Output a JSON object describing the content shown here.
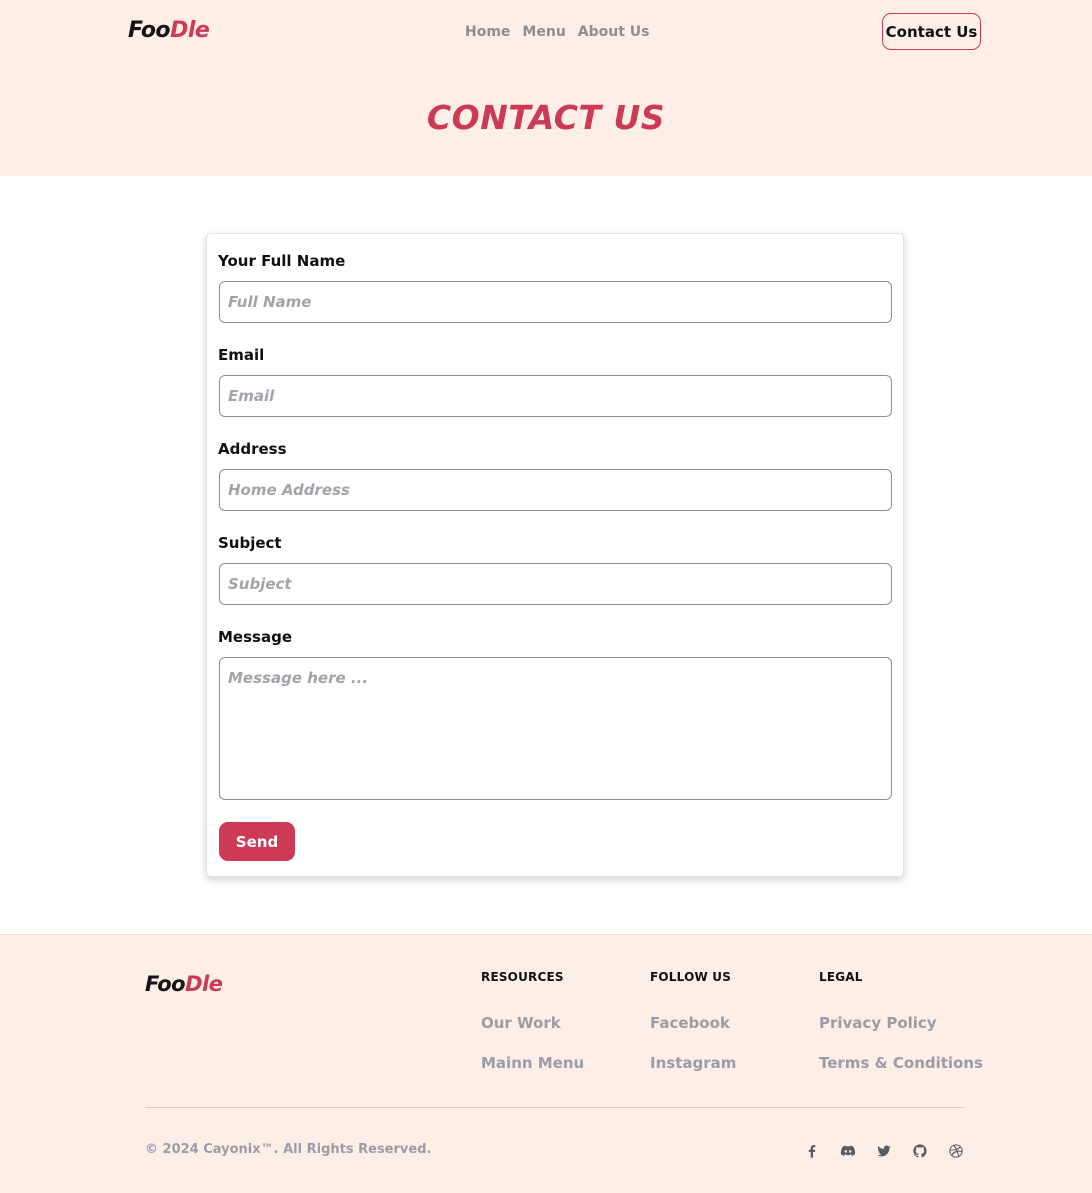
{
  "brand": {
    "part1": "Foo",
    "part2": "Dle"
  },
  "nav": {
    "home": "Home",
    "menu": "Menu",
    "about": "About Us"
  },
  "header": {
    "contact_button": "Contact Us",
    "title": "CONTACT US"
  },
  "form": {
    "fields": [
      {
        "label": "Your Full Name",
        "placeholder": "Full Name"
      },
      {
        "label": "Email",
        "placeholder": "Email"
      },
      {
        "label": "Address",
        "placeholder": "Home Address"
      },
      {
        "label": "Subject",
        "placeholder": "Subject"
      },
      {
        "label": "Message",
        "placeholder": "Message here ..."
      }
    ],
    "send_label": "Send"
  },
  "footer": {
    "resources": {
      "heading": "RESOURCES",
      "links": [
        "Our Work",
        "Mainn Menu"
      ]
    },
    "follow": {
      "heading": "FOLLOW US",
      "links": [
        "Facebook",
        "Instagram"
      ]
    },
    "legal": {
      "heading": "LEGAL",
      "links": [
        "Privacy Policy",
        "Terms & Conditions"
      ]
    },
    "copyright": "© 2024 Cayonix™. All Rights Reserved.",
    "social_icons": [
      "facebook-icon",
      "discord-icon",
      "twitter-icon",
      "github-icon",
      "dribbble-icon"
    ]
  },
  "colors": {
    "accent": "#cc3a55",
    "band": "#fdeee8",
    "muted": "#9c9ca6"
  }
}
